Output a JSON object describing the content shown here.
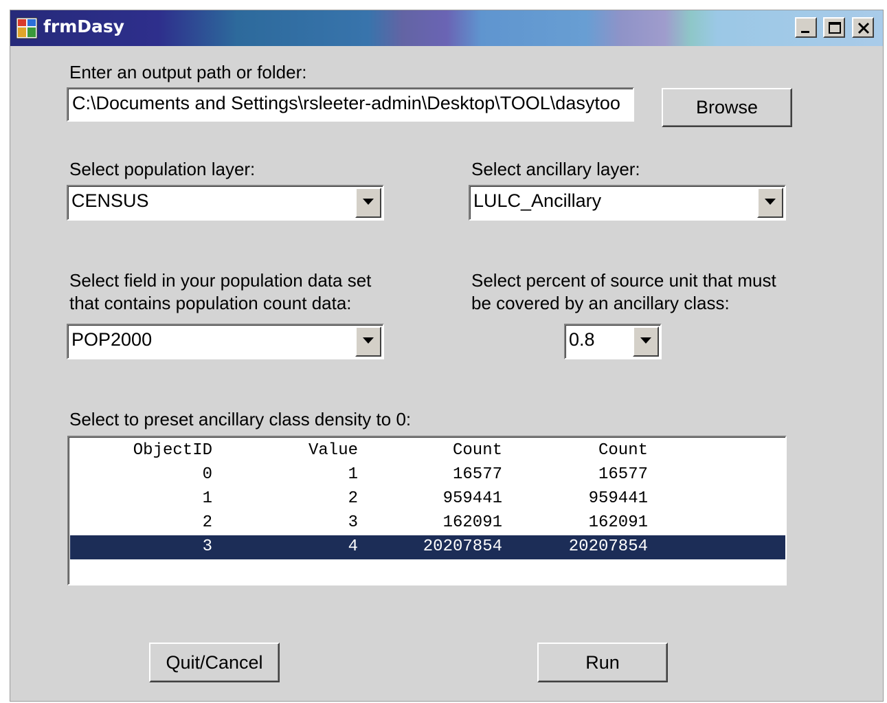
{
  "window": {
    "title": "frmDasy",
    "controls": {
      "minimize": "minimize-icon",
      "maximize": "maximize-icon",
      "close": "close-icon"
    }
  },
  "output": {
    "label": "Enter an output path or folder:",
    "path": "C:\\Documents and Settings\\rsleeter-admin\\Desktop\\TOOL\\dasytoo",
    "browse_label": "Browse"
  },
  "population_layer": {
    "label": "Select population layer:",
    "value": "CENSUS"
  },
  "ancillary_layer": {
    "label": "Select ancillary layer:",
    "value": "LULC_Ancillary"
  },
  "population_field": {
    "label_line1": "Select field in your population data set",
    "label_line2": "that contains population count data:",
    "value": "POP2000"
  },
  "percent_cover": {
    "label_line1": "Select percent of source unit that must",
    "label_line2": "be covered by an ancillary class:",
    "value": "0.8"
  },
  "preset_list": {
    "label": "Select to preset ancillary class density to 0:",
    "columns": [
      "ObjectID",
      "Value",
      "Count",
      "Count"
    ],
    "rows": [
      [
        "0",
        "1",
        "16577",
        "16577"
      ],
      [
        "1",
        "2",
        "959441",
        "959441"
      ],
      [
        "2",
        "3",
        "162091",
        "162091"
      ],
      [
        "3",
        "4",
        "20207854",
        "20207854"
      ]
    ],
    "selected_row": 3
  },
  "buttons": {
    "quit_label": "Quit/Cancel",
    "run_label": "Run"
  },
  "colors": {
    "selection": "#1c2d57",
    "form_background": "#d4d4d4"
  }
}
